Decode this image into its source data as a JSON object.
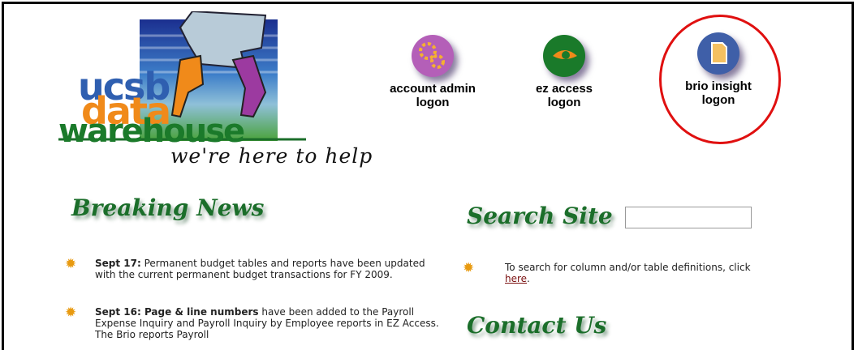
{
  "logo": {
    "word1": "ucsb",
    "word2": "data",
    "word3": "warehouse",
    "tagline": "we're here to help"
  },
  "logons": [
    {
      "line1": "account admin",
      "line2": "logon",
      "icon": "gears-icon",
      "color": "#b45fb8"
    },
    {
      "line1": "ez access",
      "line2": "logon",
      "icon": "eye-icon",
      "color": "#1a7a2a"
    },
    {
      "line1": "brio insight",
      "line2": "logon",
      "icon": "document-icon",
      "color": "#3f5fa8"
    }
  ],
  "breaking_news": {
    "title": "Breaking News",
    "items": [
      {
        "bold": "Sept 17:",
        "text": " Permanent budget tables and reports have been updated with the current permanent budget transactions for FY 2009."
      },
      {
        "bold": "Sept 16: Page & line numbers",
        "text": " have been added to the Payroll Expense Inquiry and Payroll Inquiry by Employee reports in EZ Access. The Brio reports Payroll"
      }
    ]
  },
  "search": {
    "title": "Search Site",
    "value": "",
    "text": "To search for column and/or table definitions, click ",
    "link": "here",
    "after": "."
  },
  "contact": {
    "title": "Contact Us"
  },
  "colors": {
    "accent_green": "#1b6e2a",
    "highlight_ring": "#e01010",
    "bullet": "#e89a10"
  }
}
